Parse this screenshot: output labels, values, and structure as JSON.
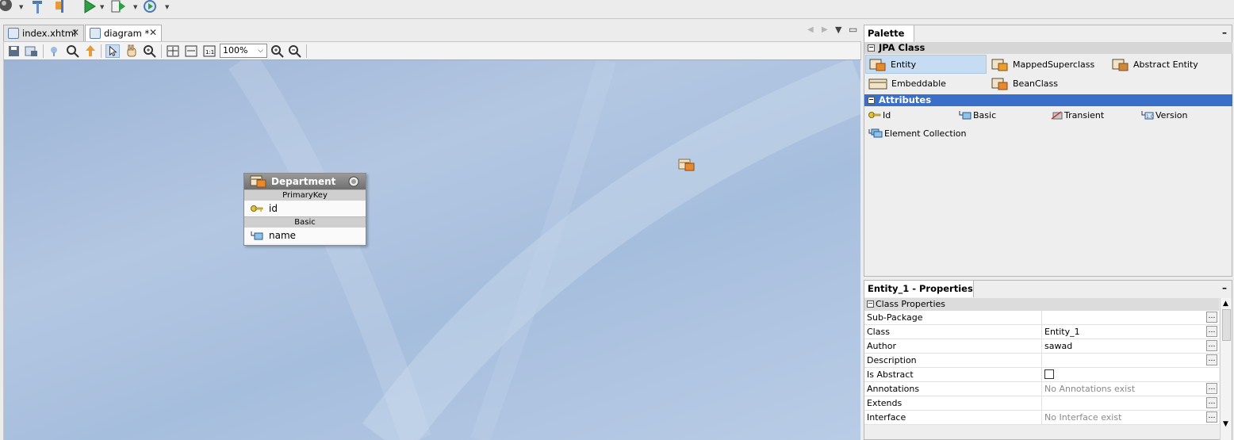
{
  "toolbar": {
    "icons": [
      "globe-icon",
      "hammer-icon",
      "clean-build-icon",
      "run-icon",
      "debug-icon",
      "profile-icon"
    ]
  },
  "editor": {
    "tabs": [
      {
        "label": "index.xhtml",
        "close": "✕"
      },
      {
        "label": "diagram *",
        "close": "✕"
      }
    ],
    "zoom": "100%"
  },
  "entity": {
    "title": "Department",
    "sections": [
      {
        "label": "PrimaryKey",
        "row": "id"
      },
      {
        "label": "Basic",
        "row": "name"
      }
    ]
  },
  "palette": {
    "tab_label": "Palette",
    "close": "✕",
    "minimize": "–",
    "categories": [
      {
        "label": "JPA Class",
        "items": [
          "Entity",
          "MappedSuperclass",
          "Abstract Entity",
          "Embeddable",
          "BeanClass"
        ]
      },
      {
        "label": "Attributes",
        "items": [
          "Id",
          "Basic",
          "Transient",
          "Version",
          "Element Collection"
        ]
      }
    ],
    "selected_item": "Entity"
  },
  "properties": {
    "tab_label": "Entity_1 - Properties",
    "close": "✕",
    "minimize": "–",
    "group_label": "Class Properties",
    "rows": [
      {
        "name": "Sub-Package",
        "value": ""
      },
      {
        "name": "Class",
        "value": "Entity_1"
      },
      {
        "name": "Author",
        "value": "sawad"
      },
      {
        "name": "Description",
        "value": ""
      },
      {
        "name": "Is Abstract",
        "value": ""
      },
      {
        "name": "Annotations",
        "value": "No Annotations exist"
      },
      {
        "name": "Extends",
        "value": ""
      },
      {
        "name": "Interface",
        "value": "No Interface exist"
      }
    ]
  },
  "colors": {
    "category_selected": "#3a6fc9",
    "item_selected": "#c5dcf3",
    "canvas": "#a9c0de"
  }
}
